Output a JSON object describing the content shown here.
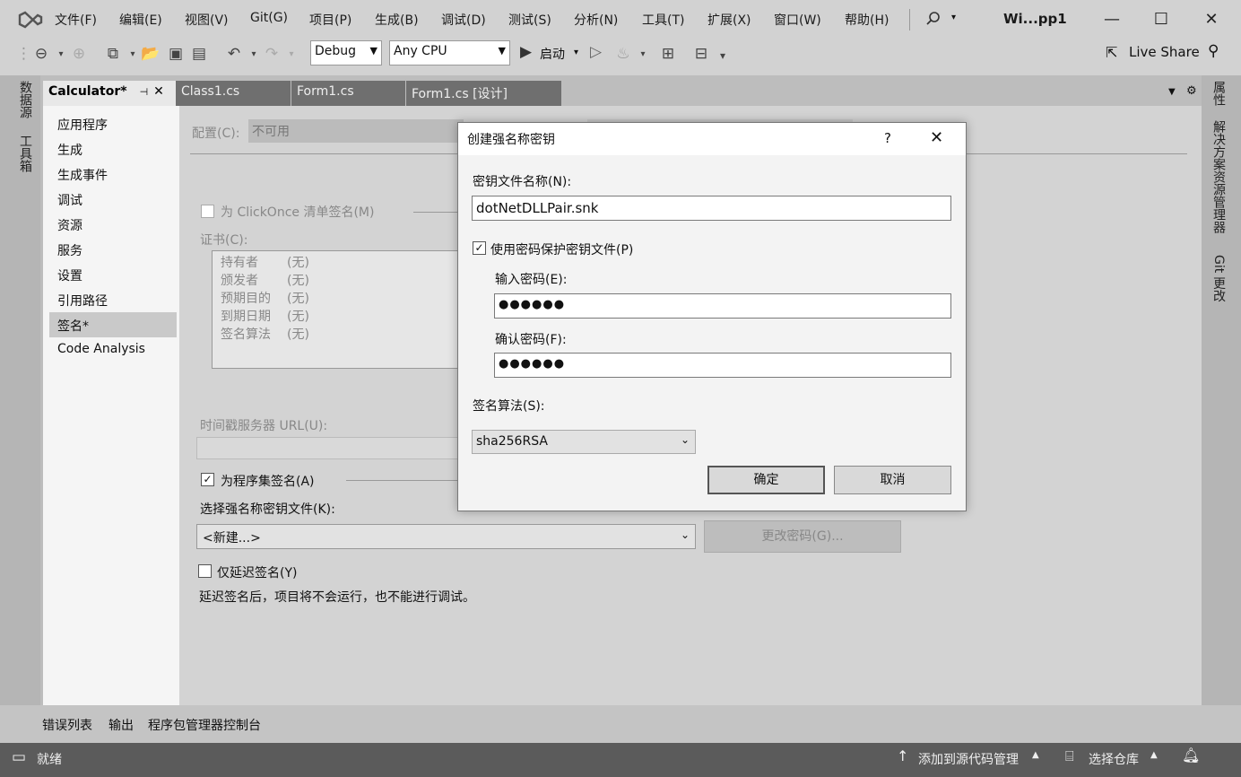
{
  "menu": {
    "items": [
      "文件(F)",
      "编辑(E)",
      "视图(V)",
      "Git(G)",
      "项目(P)",
      "生成(B)",
      "调试(D)",
      "测试(S)",
      "分析(N)",
      "工具(T)",
      "扩展(X)",
      "窗口(W)",
      "帮助(H)"
    ],
    "window_title": "Wi...pp1"
  },
  "toolbar": {
    "config": "Debug",
    "platform": "Any CPU",
    "start_label": "启动",
    "live_share": "Live Share"
  },
  "left_tabs": [
    "数据源",
    "工具箱"
  ],
  "right_tabs": [
    "属性",
    "解决方案资源管理器",
    "Git 更改"
  ],
  "doc_tabs": [
    "Calculator*",
    "Class1.cs",
    "Form1.cs",
    "Form1.cs [设计]"
  ],
  "nav": [
    "应用程序",
    "生成",
    "生成事件",
    "调试",
    "资源",
    "服务",
    "设置",
    "引用路径",
    "签名*",
    "Code Analysis"
  ],
  "page": {
    "config_label": "配置(C):",
    "config_value": "不可用",
    "clickonce_label": "为 ClickOnce 清单签名(M)",
    "cert_label": "证书(C):",
    "cert_rows": [
      {
        "k": "持有者",
        "v": "(无)"
      },
      {
        "k": "颁发者",
        "v": "(无)"
      },
      {
        "k": "预期目的",
        "v": "(无)"
      },
      {
        "k": "到期日期",
        "v": "(无)"
      },
      {
        "k": "签名算法",
        "v": "(无)"
      }
    ],
    "timestamp_label": "时间戳服务器 URL(U):",
    "sign_assembly_label": "为程序集签名(A)",
    "choose_key_label": "选择强名称密钥文件(K):",
    "key_value": "<新建...>",
    "change_pwd_button": "更改密码(G)...",
    "delay_sign_label": "仅延迟签名(Y)",
    "delay_note": "延迟签名后，项目将不会运行，也不能进行调试。"
  },
  "dialog": {
    "title": "创建强名称密钥",
    "help": "?",
    "close": "✕",
    "key_file_label": "密钥文件名称(N):",
    "key_file_value": "dotNetDLLPair.snk",
    "use_password_label": "使用密码保护密钥文件(P)",
    "enter_pwd_label": "输入密码(E):",
    "enter_pwd_value": "●●●●●●",
    "confirm_pwd_label": "确认密码(F):",
    "confirm_pwd_value": "●●●●●●",
    "algorithm_label": "签名算法(S):",
    "algorithm_value": "sha256RSA",
    "ok": "确定",
    "cancel": "取消"
  },
  "bottom_tabs": [
    "错误列表",
    "输出",
    "程序包管理器控制台"
  ],
  "status": {
    "ready": "就绪",
    "source_control": "添加到源代码管理",
    "repo": "选择仓库",
    "notifications": "1"
  }
}
